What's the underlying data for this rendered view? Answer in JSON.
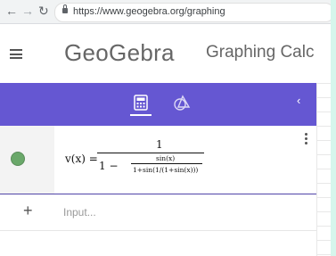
{
  "browser": {
    "back_icon": "arrow-left",
    "forward_icon": "arrow-right",
    "reload_icon": "reload",
    "lock_icon": "lock",
    "url": "https://www.geogebra.org/graphing"
  },
  "header": {
    "menu_icon": "hamburger-menu",
    "logo_text": "GeoGebra",
    "app_title": "Graphing Calc"
  },
  "toolbar": {
    "color": "#6557d2",
    "tabs": [
      {
        "icon": "calculator",
        "active": true
      },
      {
        "icon": "geometry-tools",
        "active": false
      }
    ],
    "collapse_icon": "chevron-left"
  },
  "algebra": {
    "rows": [
      {
        "marble_color": "#6aa86a",
        "lhs": "v(x) =",
        "numerator": "1",
        "denominator_prefix": "1 −",
        "inner_numerator": "sin(x)",
        "inner_denominator": "1+sin(1/(1+sin(x)))",
        "menu_icon": "vertical-dots"
      }
    ],
    "input_placeholder": "Input...",
    "add_icon": "plus"
  }
}
